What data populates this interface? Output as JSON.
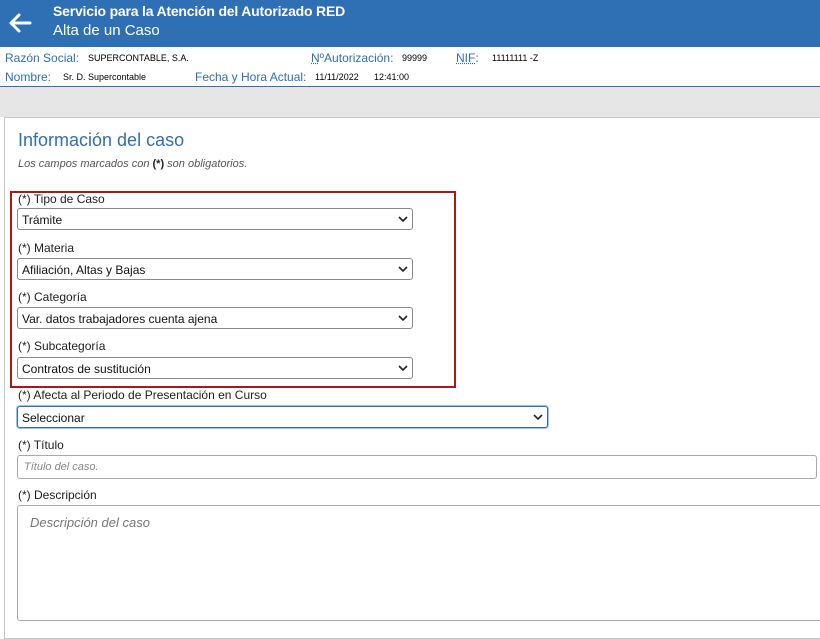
{
  "header": {
    "title": "Servicio para la Atención del Autorizado RED",
    "subtitle": "Alta de un Caso"
  },
  "info_bar": {
    "razon_social_label": "Razón Social:",
    "razon_social_value": "SUPERCONTABLE, S.A.",
    "autorizacion_label_prefix": "N",
    "autorizacion_label_rest": "ºAutorización:",
    "autorizacion_value": "99999",
    "nif_label": "NIF",
    "nif_colon": ":",
    "nif_value": "11111111 -Z",
    "nombre_label": "Nombre:",
    "nombre_value": "Sr. D. Supercontable",
    "fecha_label": "Fecha y Hora Actual:",
    "fecha_value": "11/11/2022",
    "hora_value": "12:41:00"
  },
  "form": {
    "section_title": "Información del caso",
    "note_before": "Los campos marcados con ",
    "note_mark": "(*)",
    "note_after": " son obligatorios.",
    "tipo_label": "(*) Tipo de Caso",
    "tipo_value": "Trámite",
    "materia_label": "(*) Materia",
    "materia_value": "Afiliación, Altas y Bajas",
    "categoria_label": "(*) Categoría",
    "categoria_value": "Var. datos trabajadores cuenta ajena",
    "subcategoria_label": "(*) Subcategoría",
    "subcategoria_value": "Contratos de sustitución",
    "periodo_label": "(*) Afecta al Periodo de Presentación en Curso",
    "periodo_value": "Seleccionar",
    "titulo_label": "(*) Título",
    "titulo_placeholder": "Título del caso.",
    "descripcion_label": "(*) Descripción",
    "descripcion_placeholder": "Descripción del caso"
  },
  "colors": {
    "brand": "#2f6fb4",
    "highlight": "#a31b1b"
  }
}
